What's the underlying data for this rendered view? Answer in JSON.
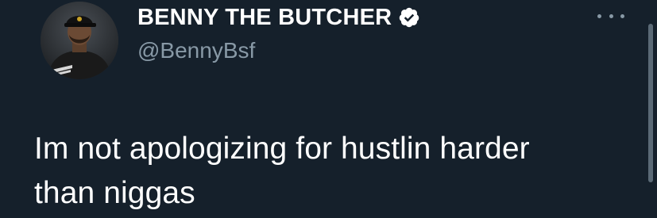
{
  "tweet": {
    "display_name": "BENNY THE BUTCHER",
    "handle": "@BennyBsf",
    "text_line1": "Im not apologizing for hustlin harder",
    "text_line2": "than niggas",
    "verified": true
  },
  "icons": {
    "verified": "verified-badge-icon",
    "more": "more-options-icon"
  },
  "colors": {
    "background": "#15202b",
    "primary_text": "#ffffff",
    "secondary_text": "#8899a6",
    "verified_badge": "#ffffff"
  }
}
